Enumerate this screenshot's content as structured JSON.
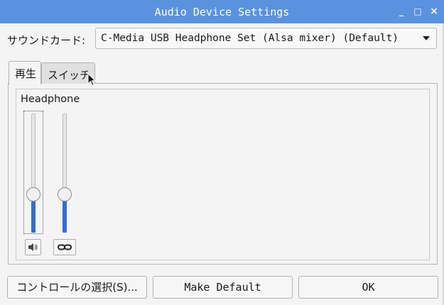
{
  "window": {
    "title": "Audio Device Settings",
    "minimize_glyph": "_",
    "maximize_glyph": "□",
    "close_glyph": "×"
  },
  "sound_card": {
    "label": "サウンドカード:",
    "selected": "C-Media USB Headphone Set (Alsa mixer) (Default)"
  },
  "tabs": [
    {
      "label": "再生",
      "active": true
    },
    {
      "label": "スイッチ",
      "active": false
    }
  ],
  "playback": {
    "section_label": "Headphone",
    "sliders": [
      {
        "name": "left",
        "level_percent": 32
      },
      {
        "name": "right",
        "level_percent": 32
      }
    ],
    "mute_icon": "speaker-icon",
    "lock_icon": "chain-link-icon"
  },
  "buttons": {
    "select_controls": "コントロールの選択(S)...",
    "make_default": "Make Default",
    "ok": "OK"
  },
  "colors": {
    "titlebar": "#5b92df",
    "slider_fill": "#2f6fd6"
  }
}
